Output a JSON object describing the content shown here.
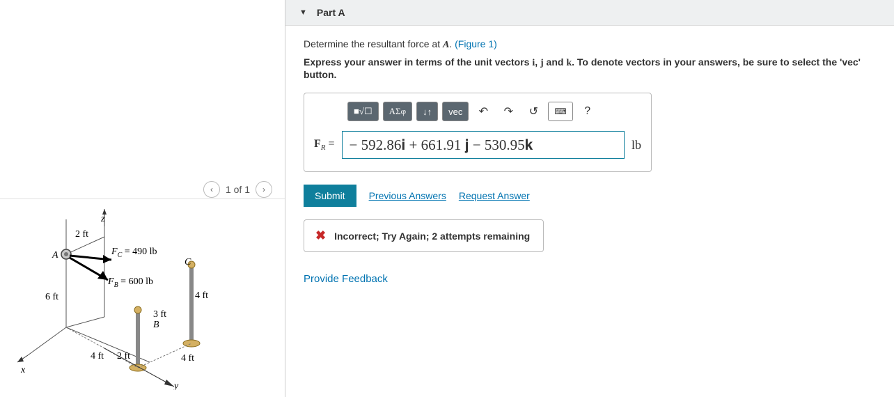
{
  "part": {
    "label": "Part A"
  },
  "prompt": {
    "line1a": "Determine the resultant force at ",
    "line1b": ". ",
    "figlink": "(Figure 1)",
    "pointA": "A",
    "bold_a": "Express your answer in terms of the unit vectors ",
    "bold_b": " and ",
    "bold_c": ". To denote vectors in your answers, be sure to select the 'vec' button.",
    "i": "i",
    "j": "j",
    "k": "k",
    "comma": ", "
  },
  "toolbar": {
    "templates": "■√☐",
    "greek": "ΑΣφ",
    "subscript": "↓↑",
    "vec": "vec",
    "undo": "↶",
    "redo": "↷",
    "reset": "↺",
    "keyboard": "⌨",
    "help": "?"
  },
  "answer": {
    "label_F": "F",
    "label_R": "R",
    "eq": " = ",
    "value": "− 592.86𝐢 + 661.91 𝐣  − 530.95𝐤",
    "unit": "lb"
  },
  "actions": {
    "submit": "Submit",
    "prev": "Previous Answers",
    "request": "Request Answer"
  },
  "feedback": {
    "icon": "✖",
    "text": "Incorrect; Try Again; 2 attempts remaining"
  },
  "provide_feedback": "Provide Feedback",
  "pager": {
    "pos": "1 of 1"
  },
  "figure": {
    "A": "A",
    "B": "B",
    "C": "C",
    "x": "x",
    "y": "y",
    "z": "z",
    "d2ft": "2 ft",
    "d6ft": "6 ft",
    "d4ft_a": "4 ft",
    "d3ft": "3 ft",
    "d4ft_b": "4 ft",
    "d2ft_b": "2 ft",
    "d4ft_c": "4 ft",
    "FC_lbl": "F",
    "FC_sub": "C",
    "FC_val": " = 490 lb",
    "FB_lbl": "F",
    "FB_sub": "B",
    "FB_val": " = 600 lb"
  }
}
